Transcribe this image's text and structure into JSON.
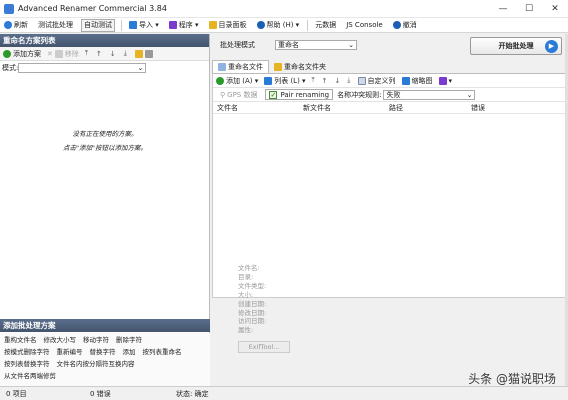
{
  "window": {
    "title": "Advanced Renamer Commercial 3.84",
    "controls": [
      "—",
      "☐",
      "✕"
    ]
  },
  "menubar": [
    {
      "label": "刷新",
      "icon": "refresh-icon",
      "color": "#2a7bd8"
    },
    {
      "label": "测试批处理"
    },
    {
      "label": "自动测试",
      "active": true
    },
    {
      "label": "导入 ▾",
      "icon": "import-icon",
      "color": "#2a7bd8"
    },
    {
      "label": "程序 ▾",
      "icon": "puzzle-icon",
      "color": "#7a3bd0"
    },
    {
      "label": "目录面板",
      "icon": "folder-icon",
      "color": "#e6b422"
    },
    {
      "label": "帮助 (H) ▾",
      "icon": "help-icon",
      "color": "#1a5fb4"
    },
    {
      "label": "元数据"
    },
    {
      "label": "JS Console"
    },
    {
      "label": "撤消",
      "icon": "undo-icon",
      "color": "#1a5fb4"
    }
  ],
  "left": {
    "header": "重命名方案列表",
    "toolbar": {
      "add": "添加方案",
      "remove": "移除",
      "arrows": [
        "⤒",
        "↑",
        "↓",
        "⤓"
      ]
    },
    "mode_label": "模式:",
    "mode_value": "",
    "empty_line1": "没有正在使用的方案。",
    "empty_line2": "点击\"添加\"按钮以添加方案。",
    "lower_header": "添加批处理方案",
    "methods": [
      [
        "重构文件名",
        "修改大小写",
        "移动字符",
        "删除字符"
      ],
      [
        "按模式删除字符",
        "重新编号",
        "替换字符",
        "添加",
        "按列表重命名"
      ],
      [
        "按列表替换字符",
        "文件名内按分隔符互换内容"
      ],
      [
        "从文件名两端修剪"
      ]
    ]
  },
  "right": {
    "batch_label": "批处理模式",
    "batch_value": "重命名",
    "start_label": "开始批处理",
    "tabs": [
      "重命名文件",
      "重命名文件夹"
    ],
    "toolbar": {
      "add": "添加 (A) ▾",
      "list": "列表 (L) ▾",
      "arrows": [
        "⤒",
        "↑",
        "↓",
        "⤓"
      ],
      "columns": "自定义列",
      "thumbs": "缩略图"
    },
    "gps": "GPS 数据",
    "pair": "Pair renaming",
    "conflict_label": "名称冲突规则:",
    "conflict_value": "失败",
    "columns": [
      "文件名",
      "新文件名",
      "路径",
      "错误"
    ],
    "info_labels": [
      "文件名:",
      "目录:",
      "文件类型:",
      "大小:",
      "创建日期:",
      "修改日期:",
      "访问日期:",
      "属性:"
    ],
    "exif_button": "ExifTool..."
  },
  "status": {
    "items": "0 项目",
    "errors": "0 错误",
    "state": "状态: 确定"
  },
  "watermark": "头条 @猫说职场"
}
